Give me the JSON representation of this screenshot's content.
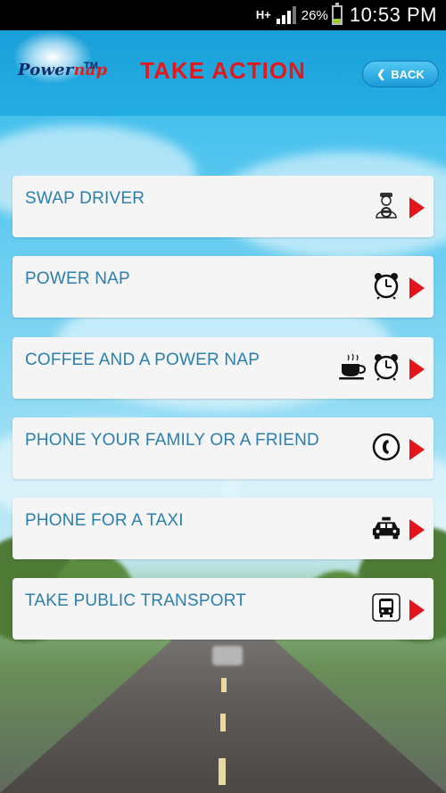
{
  "status_bar": {
    "network": "H+",
    "battery_pct": "26%",
    "time": "10:53 PM"
  },
  "header": {
    "logo_text_main": "Power",
    "logo_text_accent": "nap",
    "logo_tm": "TM",
    "title": "TAKE ACTION",
    "back_label": "BACK"
  },
  "options": [
    {
      "label": "SWAP DRIVER",
      "icons": [
        "driver-icon"
      ]
    },
    {
      "label": "POWER NAP",
      "icons": [
        "alarm-clock-icon"
      ]
    },
    {
      "label": "COFFEE AND A POWER NAP",
      "icons": [
        "coffee-cup-icon",
        "alarm-clock-icon"
      ]
    },
    {
      "label": "PHONE YOUR FAMILY OR A FRIEND",
      "icons": [
        "phone-icon"
      ]
    },
    {
      "label": "PHONE FOR A TAXI",
      "icons": [
        "taxi-icon"
      ]
    },
    {
      "label": "TAKE PUBLIC TRANSPORT",
      "icons": [
        "bus-icon"
      ]
    }
  ],
  "colors": {
    "title": "#e5171b",
    "label": "#2b7fad",
    "arrow": "#e3141b",
    "header_bg": "#1a9fd8"
  }
}
